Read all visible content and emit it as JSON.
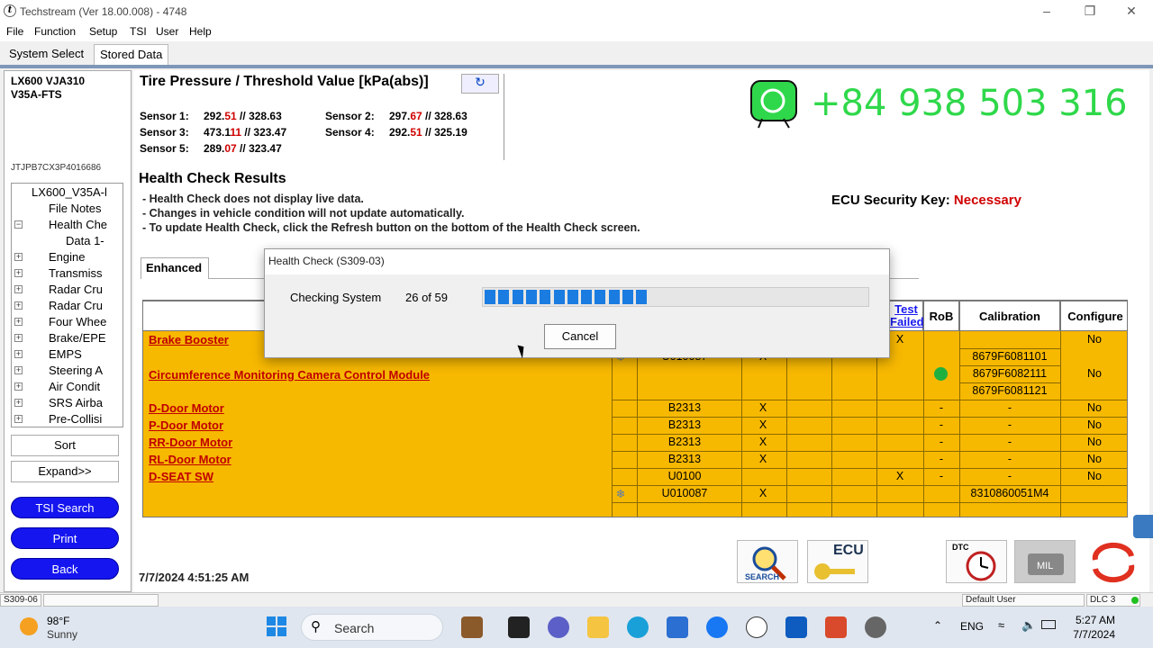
{
  "window": {
    "title": "Techstream (Ver 18.00.008) - 4748"
  },
  "menu": [
    "File",
    "Function",
    "Setup",
    "TSI",
    "User",
    "Help"
  ],
  "top_tabs": [
    "System Select",
    "Stored Data"
  ],
  "vehicle": {
    "line1": "LX600 VJA310",
    "line2": "V35A-FTS",
    "vin": "JTJPB7CX3P4016686"
  },
  "tree": [
    {
      "label": "LX600_V35A-l",
      "exp": "",
      "indent": 0
    },
    {
      "label": "File Notes",
      "exp": "",
      "indent": 1
    },
    {
      "label": "Health Chе",
      "exp": "−",
      "indent": 1
    },
    {
      "label": "Data 1-",
      "exp": "",
      "indent": 2
    },
    {
      "label": "Engine",
      "exp": "+",
      "indent": 1
    },
    {
      "label": "Transmiss",
      "exp": "+",
      "indent": 1
    },
    {
      "label": "Radar Cru",
      "exp": "+",
      "indent": 1
    },
    {
      "label": "Radar Cru",
      "exp": "+",
      "indent": 1
    },
    {
      "label": "Four Whee",
      "exp": "+",
      "indent": 1
    },
    {
      "label": "Brake/EPE",
      "exp": "+",
      "indent": 1
    },
    {
      "label": "EMPS",
      "exp": "+",
      "indent": 1
    },
    {
      "label": "Steering A",
      "exp": "+",
      "indent": 1
    },
    {
      "label": "Air Condit",
      "exp": "+",
      "indent": 1
    },
    {
      "label": "SRS Airba",
      "exp": "+",
      "indent": 1
    },
    {
      "label": "Pre-Collisi",
      "exp": "+",
      "indent": 1
    }
  ],
  "left_buttons": {
    "sort": "Sort",
    "expand": "Expand>>",
    "tsi": "TSI Search",
    "print": "Print",
    "back": "Back"
  },
  "timestamp": "7/7/2024 4:51:25 AM",
  "tire": {
    "title": "Tire Pressure / Threshold Value [kPa(abs)]",
    "sensors": [
      {
        "label": "Sensor 1:",
        "a": "292.51",
        "ar": "51",
        "b": "328.63",
        "br": "63"
      },
      {
        "label": "Sensor 2:",
        "a": "297.67",
        "ar": "67",
        "b": "328.63",
        "br": "63"
      },
      {
        "label": "Sensor 3:",
        "a": "473.11.",
        "ar": "11",
        "b": "323.47",
        "br": "47"
      },
      {
        "label": "Sensor 4:",
        "a": "292.51",
        "ar": "51",
        "b": "325.19",
        "br": "19"
      },
      {
        "label": "Sensor 5:",
        "a": "289.07",
        "ar": "07",
        "b": "323.47",
        "br": "47"
      }
    ]
  },
  "health": {
    "title": "Health Check Results",
    "notes": [
      "- Health Check does not display live data.",
      "- Changes in vehicle condition will not update automatically.",
      "- To update Health Check, click the Refresh button on the bottom of the Health Check screen."
    ],
    "ecu_key_label": "ECU Security Key:",
    "ecu_key_value": "Necessary",
    "tab": "Enhanced"
  },
  "table": {
    "headers": {
      "test_failed": "Test Failed",
      "rob": "RoB",
      "calibration": "Calibration",
      "configure": "Configure"
    },
    "rows": [
      {
        "name": "Brake Booster",
        "dtc": "",
        "x1": "",
        "x4": "X",
        "rob": "",
        "cal": "",
        "conf": "No"
      },
      {
        "name": "",
        "dtc": "U010087",
        "x1": "X",
        "x4": "",
        "rob": "",
        "cal": "8679F6081101",
        "conf": ""
      },
      {
        "name": "Circumference Monitoring Camera Control Module",
        "dtc": "",
        "x1": "",
        "x4": "",
        "rob": "",
        "cal": "8679F6082111",
        "conf": "No"
      },
      {
        "name": "",
        "dtc": "",
        "x1": "",
        "x4": "",
        "rob": "",
        "cal": "8679F6081121",
        "conf": ""
      },
      {
        "name": "D-Door Motor",
        "dtc": "B2313",
        "x1": "X",
        "x4": "",
        "rob": "-",
        "cal": "-",
        "conf": "No"
      },
      {
        "name": "P-Door Motor",
        "dtc": "B2313",
        "x1": "X",
        "x4": "",
        "rob": "-",
        "cal": "-",
        "conf": "No"
      },
      {
        "name": "RR-Door Motor",
        "dtc": "B2313",
        "x1": "X",
        "x4": "",
        "rob": "-",
        "cal": "-",
        "conf": "No"
      },
      {
        "name": "RL-Door Motor",
        "dtc": "B2313",
        "x1": "X",
        "x4": "",
        "rob": "-",
        "cal": "-",
        "conf": "No"
      },
      {
        "name": "D-SEAT SW",
        "dtc": "U0100",
        "x1": "",
        "x4": "X",
        "rob": "-",
        "cal": "-",
        "conf": "No"
      },
      {
        "name": "",
        "dtc": "U010087",
        "x1": "X",
        "x4": "",
        "rob": "",
        "cal": "8310860051M4",
        "conf": ""
      }
    ]
  },
  "dialog": {
    "title": "Health Check (S309-03)",
    "label": "Checking System",
    "count": "26 of 59",
    "progress": 0.44,
    "cancel": "Cancel"
  },
  "overlay": {
    "phone": "+84 938 503 316"
  },
  "bottom_icons": {
    "search": "SEARCH",
    "ecu": "ECU",
    "dtc": "DTC"
  },
  "status": {
    "left": "S309-06",
    "user": "Default User",
    "dlc": "DLC 3"
  },
  "taskbar": {
    "temp": "98°F",
    "weather": "Sunny",
    "search": "Search",
    "lang": "ENG",
    "time": "5:27 AM",
    "date": "7/7/2024"
  },
  "colors": {
    "table_bg": "#f7b800",
    "link": "#c00000",
    "blue_button": "#1515f0",
    "progress": "#1a7ce0",
    "phone": "#2fd84a"
  }
}
